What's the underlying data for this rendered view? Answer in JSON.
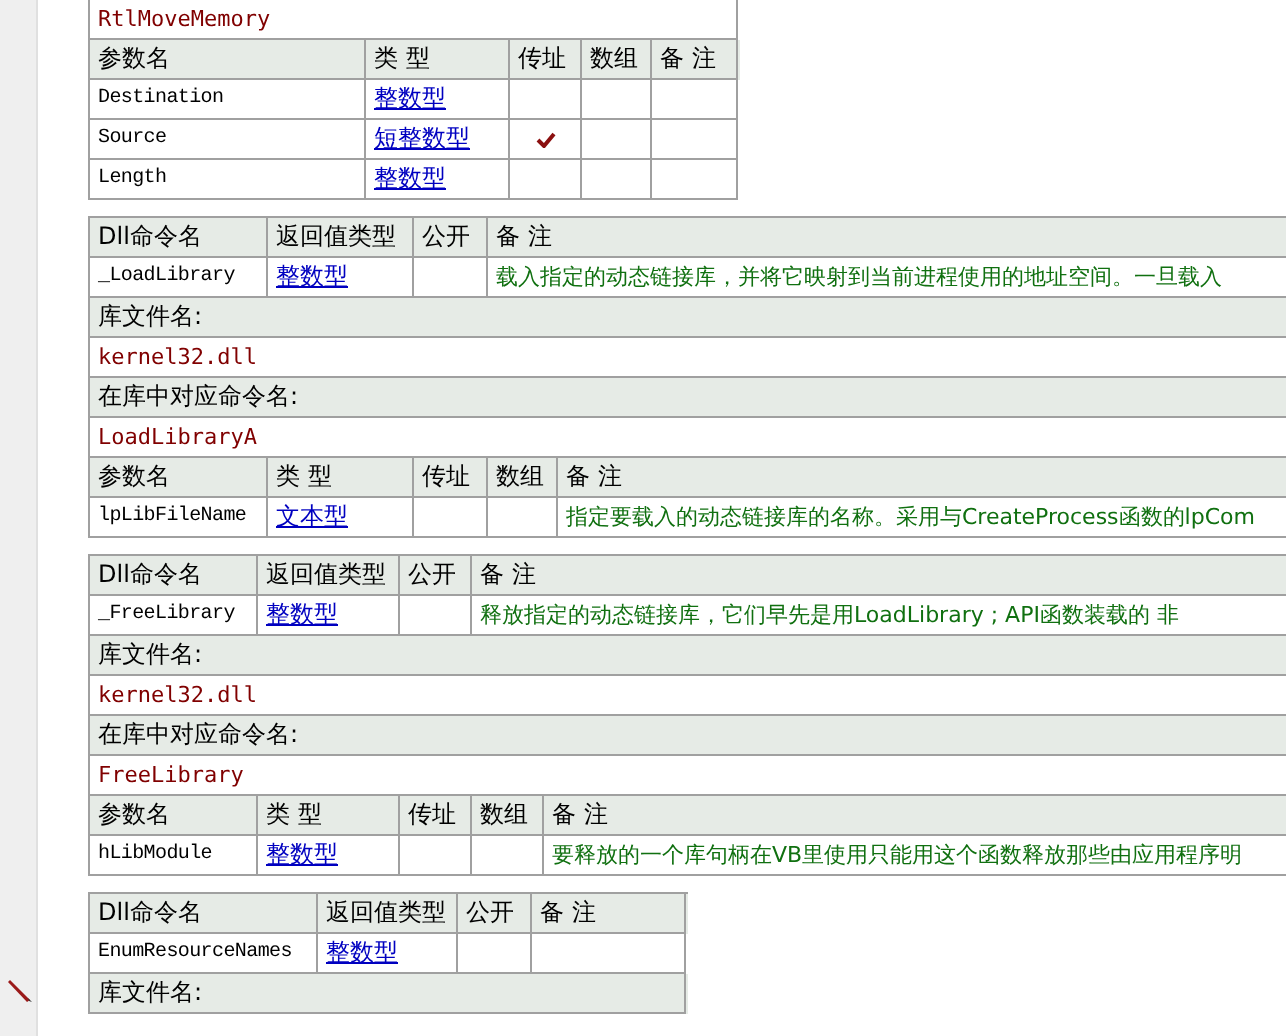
{
  "blocks": [
    {
      "alias": "RtlMoveMemory",
      "param_header": [
        "参数名",
        "类 型",
        "传址",
        "数组",
        "备 注"
      ],
      "params": [
        {
          "name": "Destination",
          "type": "整数型",
          "by_ref": false,
          "array": false
        },
        {
          "name": "Source",
          "type": "短整数型",
          "by_ref": true,
          "array": false
        },
        {
          "name": "Length",
          "type": "整数型",
          "by_ref": false,
          "array": false
        }
      ]
    },
    {
      "dll_header": [
        "Dll命令名",
        "返回值类型",
        "公开",
        "备 注"
      ],
      "dll": {
        "name": "_LoadLibrary",
        "return_type": "整数型",
        "public": false,
        "remark": "载入指定的动态链接库，并将它映射到当前进程使用的地址空间。一旦载入"
      },
      "lib_file_label": "库文件名:",
      "lib_file": "kernel32.dll",
      "alias_label": "在库中对应命令名:",
      "alias": "LoadLibraryA",
      "param_header": [
        "参数名",
        "类 型",
        "传址",
        "数组",
        "备 注"
      ],
      "params": [
        {
          "name": "lpLibFileName",
          "type": "文本型",
          "by_ref": false,
          "array": false,
          "remark": "指定要载入的动态链接库的名称。采用与CreateProcess函数的lpCom"
        }
      ]
    },
    {
      "dll_header": [
        "Dll命令名",
        "返回值类型",
        "公开",
        "备 注"
      ],
      "dll": {
        "name": "_FreeLibrary",
        "return_type": "整数型",
        "public": false,
        "remark": "释放指定的动态链接库，它们早先是用LoadLibrary ;    API函数装载的  非"
      },
      "lib_file_label": "库文件名:",
      "lib_file": "kernel32.dll",
      "alias_label": "在库中对应命令名:",
      "alias": "FreeLibrary",
      "param_header": [
        "参数名",
        "类 型",
        "传址",
        "数组",
        "备 注"
      ],
      "params": [
        {
          "name": "hLibModule",
          "type": "整数型",
          "by_ref": false,
          "array": false,
          "remark": "要释放的一个库句柄在VB里使用只能用这个函数释放那些由应用程序明"
        }
      ]
    },
    {
      "dll_header": [
        "Dll命令名",
        "返回值类型",
        "公开",
        "备 注"
      ],
      "dll": {
        "name": "EnumResourceNames",
        "return_type": "整数型",
        "public": false
      },
      "lib_file_label": "库文件名:"
    }
  ]
}
